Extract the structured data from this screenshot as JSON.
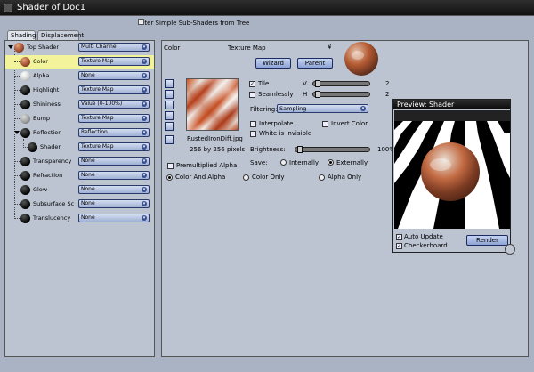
{
  "window": {
    "title": "Shader of Doc1"
  },
  "filter": {
    "label": "Filter Simple Sub-Shaders from Tree"
  },
  "tabs": [
    {
      "label": "Shading"
    },
    {
      "label": "Displacement"
    }
  ],
  "tree": [
    {
      "label": "Top Shader",
      "value": "Multi Channel",
      "swatch": "rust"
    },
    {
      "label": "Color",
      "value": "Texture Map",
      "swatch": "rust"
    },
    {
      "label": "Alpha",
      "value": "None",
      "swatch": "white"
    },
    {
      "label": "Highlight",
      "value": "Texture Map",
      "swatch": "black"
    },
    {
      "label": "Shininess",
      "value": "Value (0-100%)",
      "swatch": "black"
    },
    {
      "label": "Bump",
      "value": "Texture Map",
      "swatch": "gray"
    },
    {
      "label": "Reflection",
      "value": "Reflection",
      "swatch": "black"
    },
    {
      "label": "Shader",
      "value": "Texture Map",
      "swatch": "black"
    },
    {
      "label": "Transparency",
      "value": "None",
      "swatch": "black"
    },
    {
      "label": "Refraction",
      "value": "None",
      "swatch": "black"
    },
    {
      "label": "Glow",
      "value": "None",
      "swatch": "black"
    },
    {
      "label": "Subsurface Sc",
      "value": "None",
      "swatch": "black"
    },
    {
      "label": "Translucency",
      "value": "None",
      "swatch": "black"
    }
  ],
  "main": {
    "channel_label": "Color",
    "type_label": "Texture Map",
    "wizard_label": "Wizard",
    "parent_label": "Parent",
    "file_name": "RustedIronDiff.jpg",
    "file_size": "256 by 256 pixels",
    "tile_label": "Tile",
    "seamlessly_label": "Seamlessly",
    "v_label": "V",
    "h_label": "H",
    "v_value": "2",
    "h_value": "2",
    "filtering_label": "Filtering:",
    "filtering_value": "Sampling",
    "interpolate_label": "Interpolate",
    "invert_label": "Invert Color",
    "white_invisible_label": "White is invisible",
    "brightness_label": "Brightness:",
    "brightness_value": "100%",
    "save_label": "Save:",
    "internally_label": "Internally",
    "externally_label": "Externally",
    "premultiplied_label": "Premultiplied Alpha",
    "color_alpha_label": "Color And Alpha",
    "color_only_label": "Color Only",
    "alpha_only_label": "Alpha Only"
  },
  "preview": {
    "title": "Preview: Shader",
    "auto_update_label": "Auto Update",
    "checkerboard_label": "Checkerboard",
    "render_label": "Render"
  }
}
